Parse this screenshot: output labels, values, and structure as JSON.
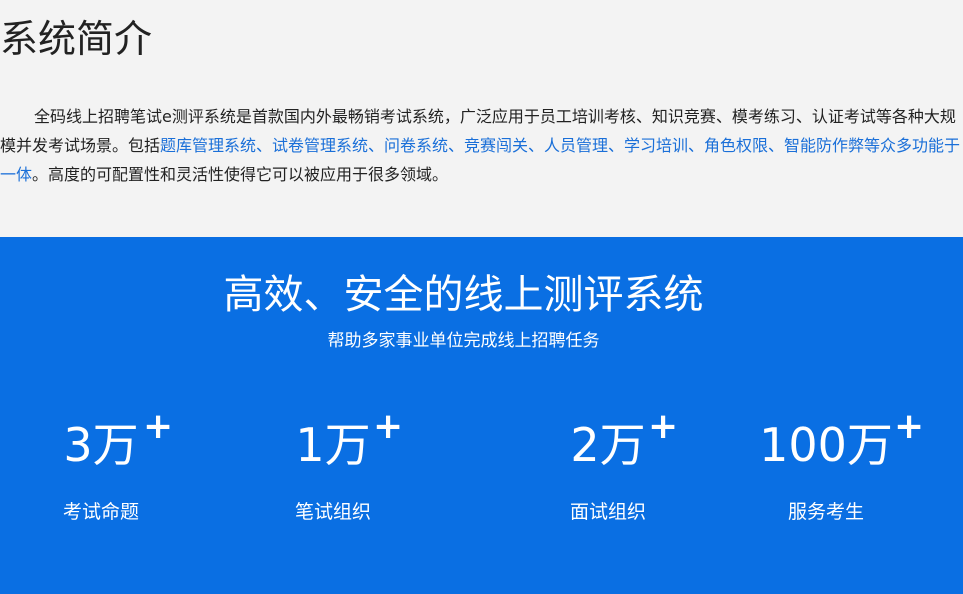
{
  "intro": {
    "title": "系统简介",
    "text_prefix": "全码线上招聘笔试e测评系统是首款国内外最畅销考试系统，广泛应用于员工培训考核、知识竞赛、模考练习、认证考试等各种大规模并发考试场景。包括",
    "features_link": "题库管理系统、试卷管理系统、问卷系统、竞赛闯关、人员管理、学习培训、角色权限、智能防作弊等众多功能于一体",
    "text_suffix": "。高度的可配置性和灵活性使得它可以被应用于很多领域。",
    "link_color": "#1a6fd8"
  },
  "stats_section": {
    "heading": "高效、安全的线上测评系统",
    "subheading": "帮助多家事业单位完成线上招聘任务",
    "background_color": "#0a6fe3",
    "items": [
      {
        "value": "3万",
        "plus": "+",
        "label": "考试命题"
      },
      {
        "value": "1万",
        "plus": "+",
        "label": "笔试组织"
      },
      {
        "value": "2万",
        "plus": "+",
        "label": "面试组织"
      },
      {
        "value": "100万",
        "plus": "+",
        "label": "服务考生"
      }
    ]
  }
}
